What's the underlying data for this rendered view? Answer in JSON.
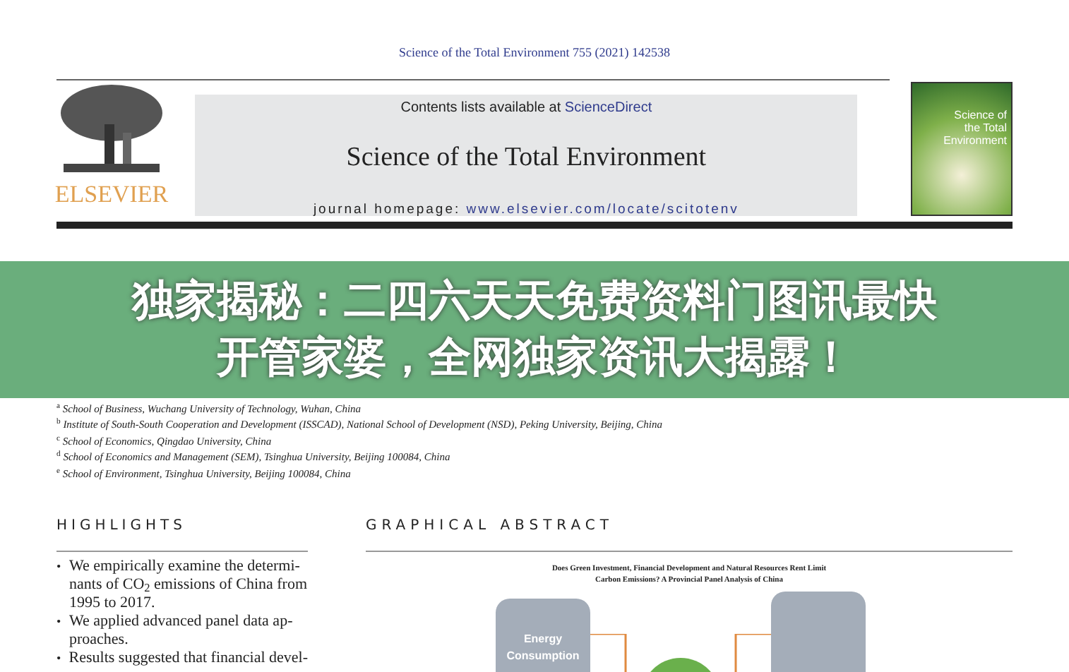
{
  "citation": "Science of the Total Environment 755 (2021) 142538",
  "header": {
    "contents_prefix": "Contents lists available at ",
    "contents_link": "ScienceDirect",
    "journal_title": "Science of the Total Environment",
    "homepage_label": "journal homepage: ",
    "homepage_url": "www.elsevier.com/locate/scitotenv",
    "publisher": "ELSEVIER",
    "cover_title": "Science of the Total Environment"
  },
  "banner": {
    "lines": [
      "独家揭秘：二四六天天免费资料门图讯最快",
      "开管家婆，全网独家资讯大揭露！"
    ]
  },
  "affiliations": [
    {
      "mark": "a",
      "text": "School of Business, Wuchang University of Technology, Wuhan, China"
    },
    {
      "mark": "b",
      "text": "Institute of South-South Cooperation and Development (ISSCAD), National School of Development (NSD), Peking University, Beijing, China"
    },
    {
      "mark": "c",
      "text": "School of Economics, Qingdao University, China"
    },
    {
      "mark": "d",
      "text": "School of Economics and Management (SEM), Tsinghua University, Beijing 100084, China"
    },
    {
      "mark": "e",
      "text": "School of Environment, Tsinghua University, Beijing 100084, China"
    }
  ],
  "highlights": {
    "heading": "HIGHLIGHTS",
    "items": [
      {
        "bullet": "•",
        "lines": [
          "We empirically examine the determi-",
          "nants of CO$_{2}$ emissions of China from",
          "1995 to 2017."
        ]
      },
      {
        "bullet": "•",
        "lines": [
          "We applied advanced panel data ap-",
          "proaches."
        ]
      },
      {
        "bullet": "•",
        "lines": [
          "Results suggested that financial devel-"
        ]
      }
    ]
  },
  "graphical_abstract": {
    "heading": "GRAPHICAL ABSTRACT",
    "title_lines": [
      "Does Green Investment, Financial Development and Natural Resources Rent Limit",
      "Carbon Emissions? A Provincial Panel Analysis of China"
    ],
    "box_label": "Energy Consumption"
  }
}
